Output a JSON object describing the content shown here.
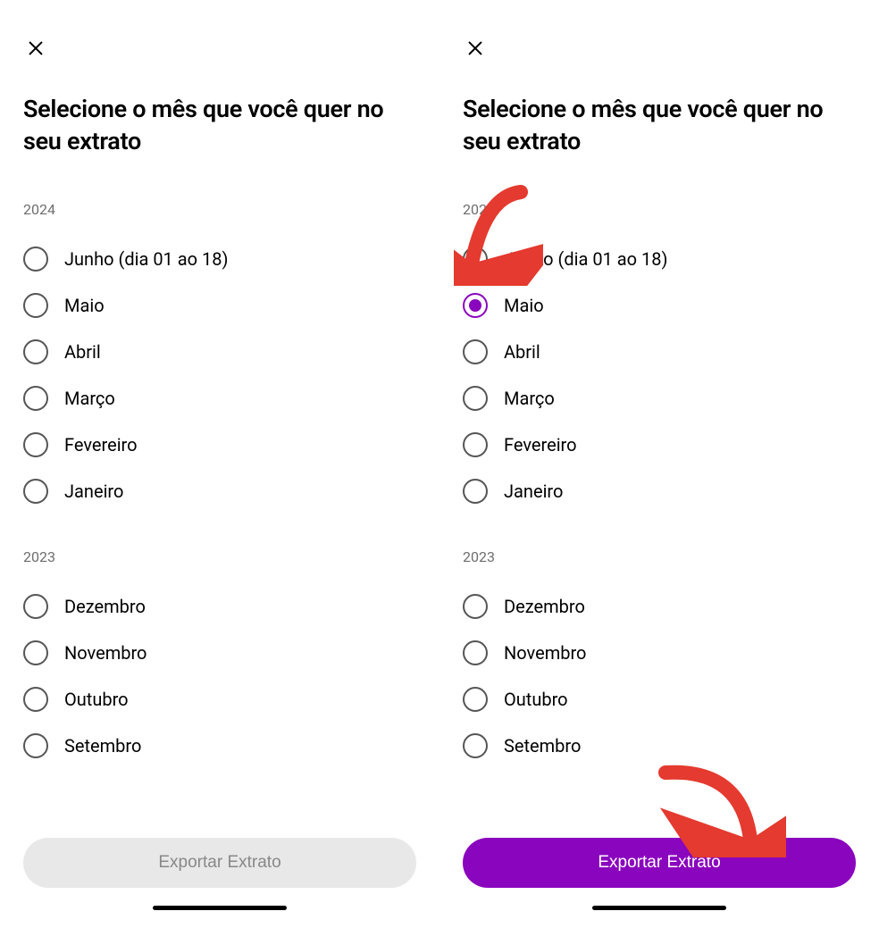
{
  "left": {
    "heading": "Selecione o mês que você quer no seu extrato",
    "sections": [
      {
        "year": "2024",
        "months": [
          {
            "label": "Junho (dia 01 ao 18)",
            "selected": false
          },
          {
            "label": "Maio",
            "selected": false
          },
          {
            "label": "Abril",
            "selected": false
          },
          {
            "label": "Março",
            "selected": false
          },
          {
            "label": "Fevereiro",
            "selected": false
          },
          {
            "label": "Janeiro",
            "selected": false
          }
        ]
      },
      {
        "year": "2023",
        "months": [
          {
            "label": "Dezembro",
            "selected": false
          },
          {
            "label": "Novembro",
            "selected": false
          },
          {
            "label": "Outubro",
            "selected": false
          },
          {
            "label": "Setembro",
            "selected": false
          }
        ]
      }
    ],
    "button_label": "Exportar Extrato",
    "button_state": "disabled"
  },
  "right": {
    "heading": "Selecione o mês que você quer no seu extrato",
    "sections": [
      {
        "year": "2024",
        "months": [
          {
            "label": "Junho (dia 01 ao 18)",
            "selected": false
          },
          {
            "label": "Maio",
            "selected": true
          },
          {
            "label": "Abril",
            "selected": false
          },
          {
            "label": "Março",
            "selected": false
          },
          {
            "label": "Fevereiro",
            "selected": false
          },
          {
            "label": "Janeiro",
            "selected": false
          }
        ]
      },
      {
        "year": "2023",
        "months": [
          {
            "label": "Dezembro",
            "selected": false
          },
          {
            "label": "Novembro",
            "selected": false
          },
          {
            "label": "Outubro",
            "selected": false
          },
          {
            "label": "Setembro",
            "selected": false
          }
        ]
      }
    ],
    "button_label": "Exportar Extrato",
    "button_state": "enabled"
  },
  "colors": {
    "accent": "#8a05be",
    "annotation": "#e43a2f"
  }
}
